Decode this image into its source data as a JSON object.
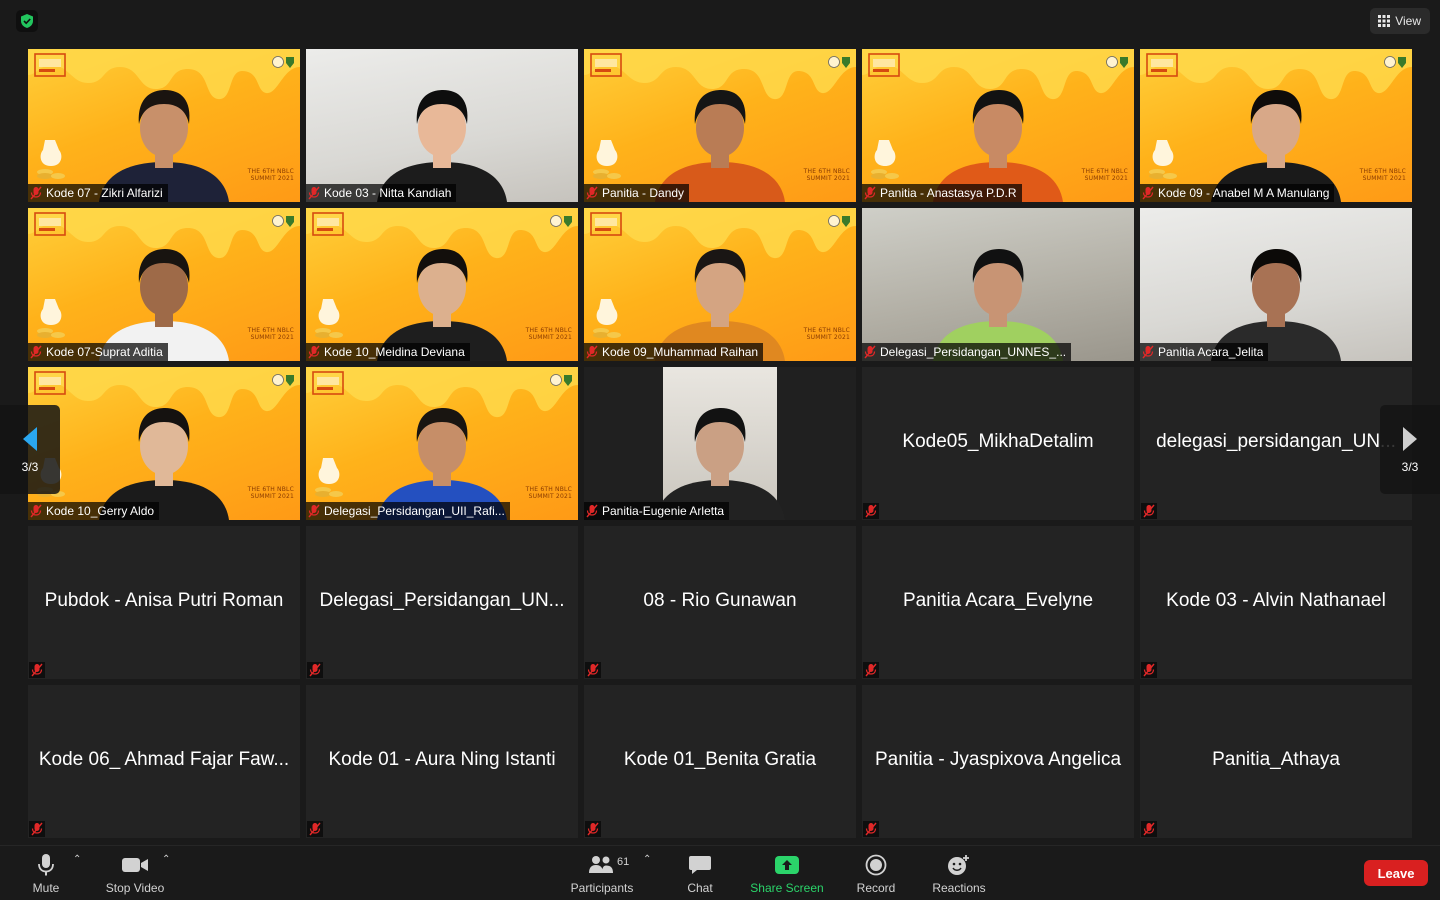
{
  "top_bar": {
    "view_label": "View"
  },
  "pager": {
    "left_label": "3/3",
    "right_label": "3/3"
  },
  "tiles": [
    {
      "name": "Kode 07 - Zikri Alfarizi",
      "kind": "video"
    },
    {
      "name": "Kode 03 - Nitta Kandiah",
      "kind": "video"
    },
    {
      "name": "Panitia - Dandy",
      "kind": "video"
    },
    {
      "name": "Panitia - Anastasya P.D.R",
      "kind": "video"
    },
    {
      "name": "Kode 09 - Anabel M A Manulang",
      "kind": "video"
    },
    {
      "name": "Kode 07-Suprat Aditia",
      "kind": "video"
    },
    {
      "name": "Kode 10_Meidina Deviana",
      "kind": "video"
    },
    {
      "name": "Kode 09_Muhammad Raihan",
      "kind": "video"
    },
    {
      "name": "Delegasi_Persidangan_UNNES_...",
      "kind": "video"
    },
    {
      "name": "Panitia Acara_Jelita",
      "kind": "video"
    },
    {
      "name": "Kode 10_Gerry Aldo",
      "kind": "video"
    },
    {
      "name": "Delegasi_Persidangan_UII_Rafi...",
      "kind": "video"
    },
    {
      "name": "Panitia-Eugenie Arletta",
      "kind": "video"
    },
    {
      "name": "Kode05_MikhaDetalim",
      "kind": "off"
    },
    {
      "name": "delegasi_persidangan_UN...",
      "kind": "off"
    },
    {
      "name": "Pubdok - Anisa Putri Roman",
      "kind": "off"
    },
    {
      "name": "Delegasi_Persidangan_UN...",
      "kind": "off"
    },
    {
      "name": "08 - Rio Gunawan",
      "kind": "off"
    },
    {
      "name": "Panitia Acara_Evelyne",
      "kind": "off"
    },
    {
      "name": "Kode 03 - Alvin Nathanael",
      "kind": "off"
    },
    {
      "name": "Kode 06_ Ahmad Fajar Faw...",
      "kind": "off"
    },
    {
      "name": "Kode 01 - Aura Ning Istanti",
      "kind": "off"
    },
    {
      "name": "Kode 01_Benita Gratia",
      "kind": "off"
    },
    {
      "name": "Panitia - Jyaspixova Angelica",
      "kind": "off"
    },
    {
      "name": "Panitia_Athaya",
      "kind": "off"
    }
  ],
  "toolbar": {
    "mute_label": "Mute",
    "video_label": "Stop Video",
    "participants_label": "Participants",
    "participants_count": "61",
    "chat_label": "Chat",
    "share_label": "Share Screen",
    "record_label": "Record",
    "reactions_label": "Reactions",
    "leave_label": "Leave"
  },
  "colors": {
    "accent_green": "#2bd46a",
    "leave_red": "#d92020",
    "mute_red": "#e02828",
    "pager_blue": "#2aa7f0"
  }
}
